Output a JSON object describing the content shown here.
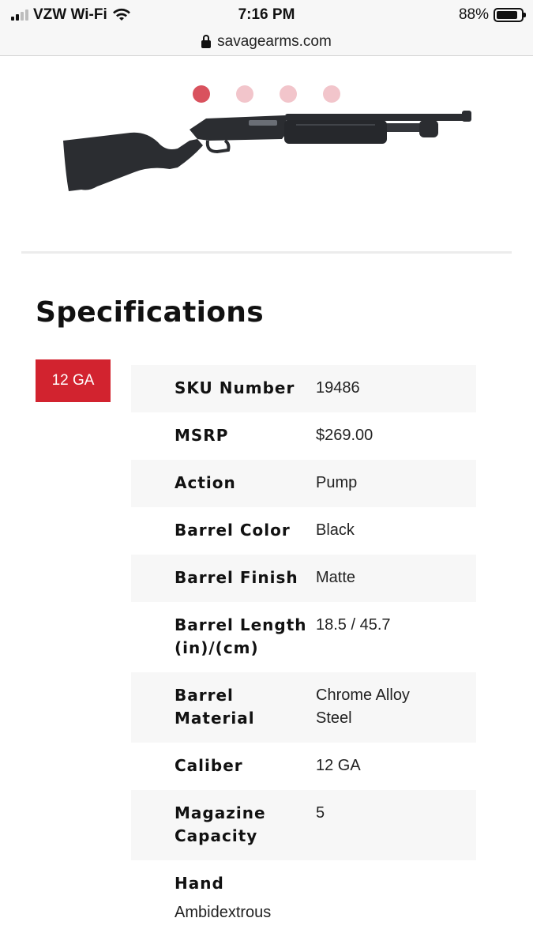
{
  "status_bar": {
    "carrier": "VZW Wi-Fi",
    "time": "7:16 PM",
    "battery": "88%",
    "battery_level": 0.88
  },
  "url_bar": {
    "domain": "savagearms.com"
  },
  "carousel": {
    "slide_count": 4,
    "active_index": 0
  },
  "product_image": {
    "description_icon": "pump-shotgun-image",
    "colors": {
      "gun": "#2b2d31",
      "highlight": "#4a4d53"
    }
  },
  "specifications": {
    "title": "Specifications",
    "caliber_tab": "12 GA",
    "rows": [
      {
        "label": "SKU Number",
        "value": "19486"
      },
      {
        "label": "MSRP",
        "value": "$269.00"
      },
      {
        "label": "Action",
        "value": "Pump"
      },
      {
        "label": "Barrel Color",
        "value": "Black"
      },
      {
        "label": "Barrel Finish",
        "value": "Matte"
      },
      {
        "label": "Barrel Length (in)/(cm)",
        "value": "18.5 / 45.7"
      },
      {
        "label": "Barrel Material",
        "value": "Chrome Alloy Steel"
      },
      {
        "label": "Caliber",
        "value": "12 GA"
      },
      {
        "label": "Magazine Capacity",
        "value": "5"
      },
      {
        "label": "Hand",
        "value": "Ambidextrous"
      }
    ]
  },
  "colors": {
    "accent": "#d2232f",
    "dot_active": "#d9525e",
    "dot_inactive": "#f2c5cb",
    "row_shade": "#f7f7f7"
  }
}
